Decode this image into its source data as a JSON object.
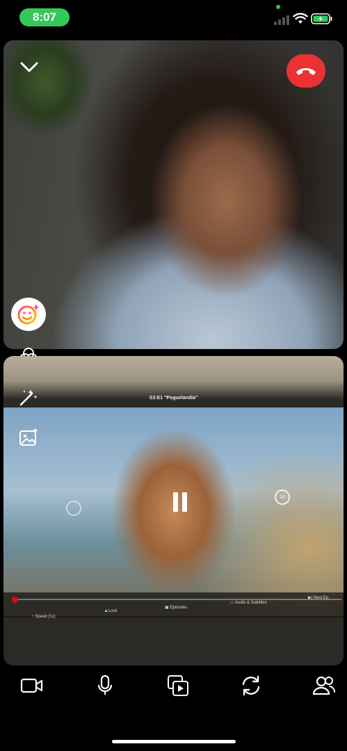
{
  "status_bar": {
    "time": "8:07",
    "indicator_color": "#34c759",
    "icons": [
      "cellular-signal-icon",
      "wifi-icon",
      "battery-charging-icon"
    ]
  },
  "call": {
    "top_tile": {
      "icons": [
        "chevron-down-icon",
        "end-call-icon"
      ],
      "end_call_color": "#ea3233"
    },
    "effects": [
      "face-effects-icon",
      "filters-icon",
      "magic-wand-icon",
      "background-image-icon"
    ],
    "shared_video": {
      "episode_title": "S3:E1 \"Poguelandia\"",
      "controls": {
        "speed": "Speed (1x)",
        "lock": "Lock",
        "episodes": "Episodes",
        "audio_subtitles": "Audio & Subtitles",
        "next_episode": "Next Ep."
      },
      "skip_forward": "10",
      "accent_color": "#e50914"
    }
  },
  "toolbar": {
    "items": [
      "camera-icon",
      "microphone-icon",
      "share-media-icon",
      "flip-camera-icon",
      "participants-icon"
    ]
  }
}
